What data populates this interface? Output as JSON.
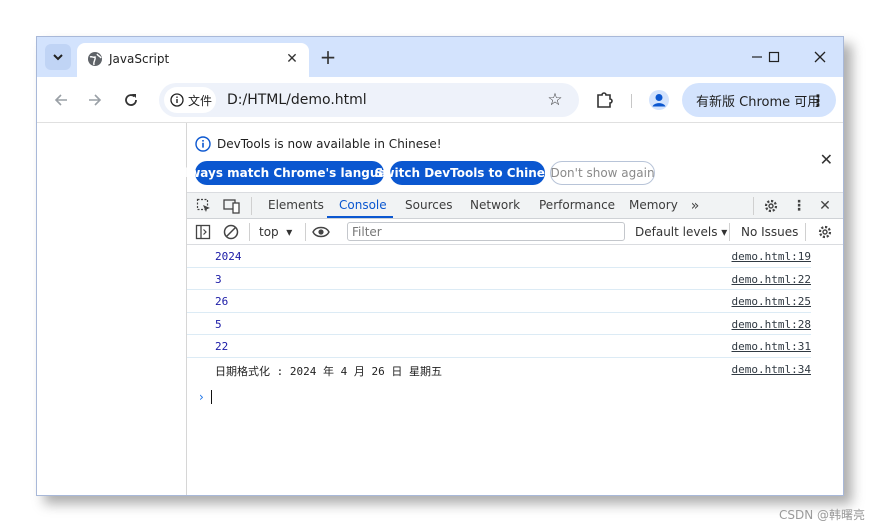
{
  "browser": {
    "tab_title": "JavaScript",
    "url_chip_label": "文件",
    "url": "D:/HTML/demo.html",
    "update_button_label": "有新版 Chrome 可用"
  },
  "devtools": {
    "infobar": {
      "message": "DevTools is now available in Chinese!",
      "btn_match": "Always match Chrome's language",
      "btn_switch": "Switch DevTools to Chinese",
      "btn_dismiss": "Don't show again"
    },
    "tabs": [
      "Elements",
      "Console",
      "Sources",
      "Network",
      "Performance",
      "Memory"
    ],
    "active_tab": "Console",
    "console": {
      "context": "top",
      "filter_placeholder": "Filter",
      "levels": "Default levels",
      "issues": "No Issues",
      "logs": [
        {
          "message": "2024",
          "source": "demo.html:19",
          "kind": "number"
        },
        {
          "message": "3",
          "source": "demo.html:22",
          "kind": "number"
        },
        {
          "message": "26",
          "source": "demo.html:25",
          "kind": "number"
        },
        {
          "message": "5",
          "source": "demo.html:28",
          "kind": "number"
        },
        {
          "message": "22",
          "source": "demo.html:31",
          "kind": "number"
        },
        {
          "message": "日期格式化 : 2024 年 4 月 26 日 星期五",
          "source": "demo.html:34",
          "kind": "text"
        }
      ]
    }
  },
  "watermark": "CSDN @韩曙亮",
  "colors": {
    "tabstrip": "#d3e3fd",
    "accent": "#0b57d0",
    "number_log": "#1a1aa6"
  }
}
